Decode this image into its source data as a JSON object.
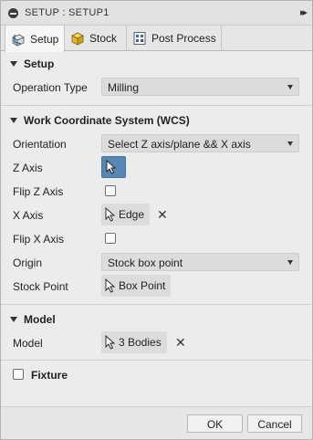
{
  "window": {
    "title": "SETUP : SETUP1"
  },
  "tabs": [
    {
      "label": "Setup",
      "icon": "setup-icon",
      "active": true
    },
    {
      "label": "Stock",
      "icon": "stock-box-icon",
      "active": false
    },
    {
      "label": "Post Process",
      "icon": "post-process-icon",
      "active": false
    }
  ],
  "setup_section": {
    "header": "Setup",
    "operation_type_label": "Operation Type",
    "operation_type_value": "Milling"
  },
  "wcs_section": {
    "header": "Work Coordinate System (WCS)",
    "orientation_label": "Orientation",
    "orientation_value": "Select Z axis/plane && X axis",
    "z_axis_label": "Z Axis",
    "flip_z_label": "Flip Z Axis",
    "flip_z_checked": false,
    "x_axis_label": "X Axis",
    "x_axis_value": "Edge",
    "flip_x_label": "Flip X Axis",
    "flip_x_checked": false,
    "origin_label": "Origin",
    "origin_value": "Stock box point",
    "stock_point_label": "Stock Point",
    "stock_point_value": "Box Point"
  },
  "model_section": {
    "header": "Model",
    "model_label": "Model",
    "model_value": "3 Bodies"
  },
  "fixture_section": {
    "label": "Fixture",
    "checked": false
  },
  "footer": {
    "ok_label": "OK",
    "cancel_label": "Cancel"
  },
  "colors": {
    "selected_picker": "#5a86b3",
    "dialog_bg": "#ececec"
  }
}
